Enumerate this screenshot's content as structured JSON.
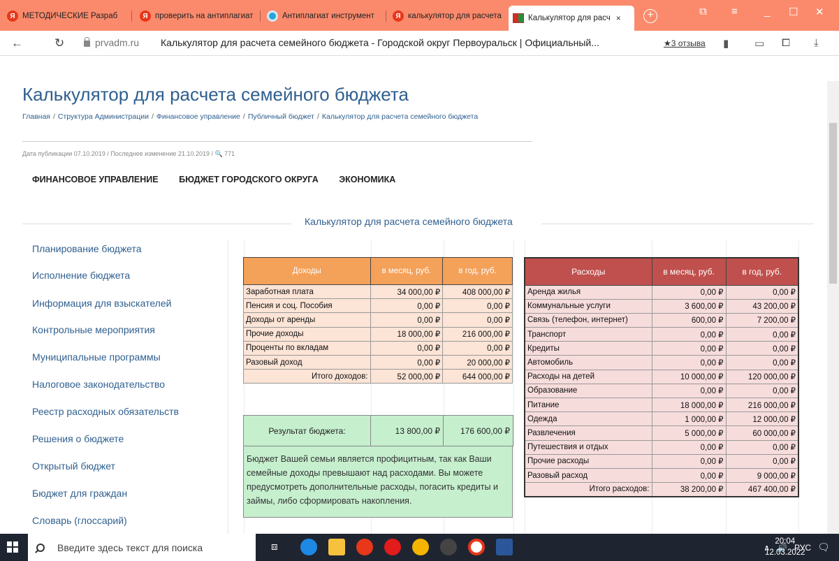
{
  "browser": {
    "tabs": [
      {
        "label": "МЕТОДИЧЕСКИЕ Разраб",
        "icon": "yandex-icon"
      },
      {
        "label": "проверить на антиплагиат",
        "icon": "yandex-icon"
      },
      {
        "label": "Антиплагиат инструмент",
        "icon": "camera-icon"
      },
      {
        "label": "калькулятор для расчета",
        "icon": "yandex-icon"
      },
      {
        "label": "Калькулятор для расч",
        "icon": "city-flag-icon",
        "active": true
      }
    ],
    "tab_close": "×",
    "new_tab": "+",
    "domain": "prvadm.ru",
    "page_title": "Калькулятор для расчета семейного бюджета - Городской округ Первоуральск | Официальный...",
    "reviews": "★3 отзыва"
  },
  "page": {
    "heading": "Калькулятор для расчета семейного бюджета",
    "breadcrumb": [
      "Главная",
      "Структура Администрации",
      "Финансовое управление",
      "Публичный бюджет",
      "Калькулятор для расчета семейного бюджета"
    ],
    "breadcrumb_sep": "/",
    "pub_info": "Дата публикации 07.10.2019 / Последнее изменение 21.10.2019 / 🔍 771",
    "menu": [
      "ФИНАНСОВОЕ УПРАВЛЕНИЕ",
      "БЮДЖЕТ ГОРОДСКОГО ОКРУГА",
      "ЭКОНОМИКА"
    ],
    "calc_title": "Калькулятор для расчета семейного бюджета",
    "sidebar": [
      "Планирование бюджета",
      "Исполнение бюджета",
      "Информация для взыскателей",
      "Контрольные мероприятия",
      "Муниципальные программы",
      "Налоговое законодательство",
      "Реестр расходных обязательств",
      "Решения о бюджете",
      "Открытый бюджет",
      "Бюджет для граждан",
      "Словарь (глоссарий)"
    ]
  },
  "income": {
    "headers": [
      "Доходы",
      "в месяц, руб.",
      "в год, руб."
    ],
    "rows": [
      [
        "Заработная плата",
        "34 000,00 ₽",
        "408 000,00 ₽"
      ],
      [
        "Пенсия и соц. Пособия",
        "0,00 ₽",
        "0,00 ₽"
      ],
      [
        "Доходы от аренды",
        "0,00 ₽",
        "0,00 ₽"
      ],
      [
        "Прочие доходы",
        "18 000,00 ₽",
        "216 000,00 ₽"
      ],
      [
        "Проценты по вкладам",
        "0,00 ₽",
        "0,00 ₽"
      ],
      [
        "Разовый доход",
        "0,00 ₽",
        "20 000,00 ₽"
      ]
    ],
    "total": [
      "Итого доходов:",
      "52 000,00 ₽",
      "644 000,00 ₽"
    ]
  },
  "result": {
    "label": "Результат бюджета:",
    "month": "13 800,00 ₽",
    "year": "176 600,00 ₽"
  },
  "advice": "Бюджет Вашей семьи является профицитным, так как Ваши семейные доходы превышают над расходами. Вы можете предусмотреть дополнительные расходы, погасить кредиты и займы, либо сформировать накопления.",
  "expenses": {
    "headers": [
      "Расходы",
      "в месяц, руб.",
      "в год, руб."
    ],
    "rows": [
      [
        "Аренда жилья",
        "0,00 ₽",
        "0,00 ₽"
      ],
      [
        "Коммунальные услуги",
        "3 600,00 ₽",
        "43 200,00 ₽"
      ],
      [
        "Связь (телефон, интернет)",
        "600,00 ₽",
        "7 200,00 ₽"
      ],
      [
        "Транспорт",
        "0,00 ₽",
        "0,00 ₽"
      ],
      [
        "Кредиты",
        "0,00 ₽",
        "0,00 ₽"
      ],
      [
        "Автомобиль",
        "0,00 ₽",
        "0,00 ₽"
      ],
      [
        "Расходы на детей",
        "10 000,00 ₽",
        "120 000,00 ₽"
      ],
      [
        "Образование",
        "0,00 ₽",
        "0,00 ₽"
      ],
      [
        "Питание",
        "18 000,00 ₽",
        "216 000,00 ₽"
      ],
      [
        "Одежда",
        "1 000,00 ₽",
        "12 000,00 ₽"
      ],
      [
        "Развлечения",
        "5 000,00 ₽",
        "60 000,00 ₽"
      ],
      [
        "Путешествия и отдых",
        "0,00 ₽",
        "0,00 ₽"
      ],
      [
        "Прочие расходы",
        "0,00 ₽",
        "0,00 ₽"
      ],
      [
        "Разовый расход",
        "0,00 ₽",
        "9 000,00 ₽"
      ]
    ],
    "total": [
      "Итого расходов:",
      "38 200,00 ₽",
      "467 400,00 ₽"
    ]
  },
  "taskbar": {
    "search_placeholder": "Введите здесь текст для поиска",
    "lang": "РУС",
    "time": "20:04",
    "date": "12.03.2022"
  },
  "colors": {
    "tabbar": "#fb8a6c",
    "link": "#2f5f8f",
    "income_header": "#f4a15a",
    "income_cell": "#fce4d6",
    "expense_header": "#c0504d",
    "expense_cell": "#f7dcdc",
    "result_green": "#c6efce"
  }
}
